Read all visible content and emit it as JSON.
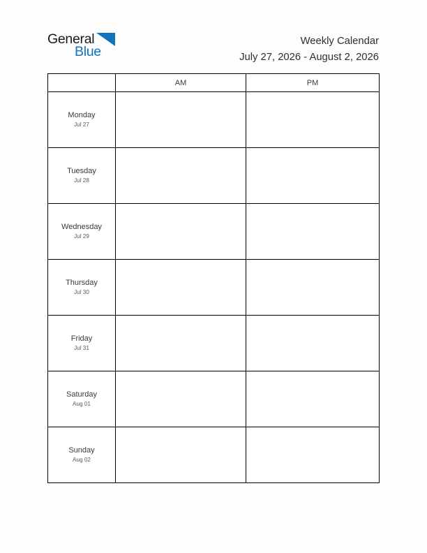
{
  "logo": {
    "word1": "General",
    "word2": "Blue",
    "triangle_icon": "triangle-icon",
    "color_dark": "#1a1a1a",
    "color_blue": "#1273bd"
  },
  "header": {
    "title": "Weekly Calendar",
    "date_range": "July 27, 2026 - August 2, 2026"
  },
  "table": {
    "columns": [
      "",
      "AM",
      "PM"
    ],
    "rows": [
      {
        "day": "Monday",
        "date": "Jul 27",
        "am": "",
        "pm": ""
      },
      {
        "day": "Tuesday",
        "date": "Jul 28",
        "am": "",
        "pm": ""
      },
      {
        "day": "Wednesday",
        "date": "Jul 29",
        "am": "",
        "pm": ""
      },
      {
        "day": "Thursday",
        "date": "Jul 30",
        "am": "",
        "pm": ""
      },
      {
        "day": "Friday",
        "date": "Jul 31",
        "am": "",
        "pm": ""
      },
      {
        "day": "Saturday",
        "date": "Aug 01",
        "am": "",
        "pm": ""
      },
      {
        "day": "Sunday",
        "date": "Aug 02",
        "am": "",
        "pm": ""
      }
    ]
  },
  "page": {
    "background": "#fdfdfd",
    "border_color": "#000000"
  }
}
